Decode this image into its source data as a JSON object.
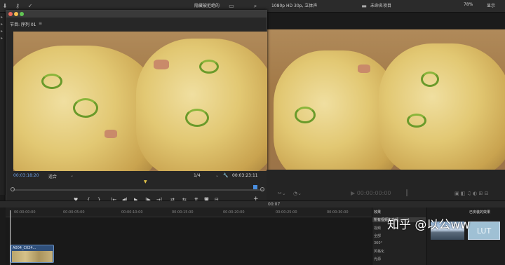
{
  "topbar": {
    "filter_label": "隐藏被拒绝的",
    "format_label": "1080p HD 30p, 立体声",
    "project_label": "未命名项目",
    "zoom_label": "78%",
    "display_label": "显示"
  },
  "viewer": {
    "title": "节目: 序列 01",
    "menu_glyph": "≡",
    "timecode_current": "00:03:18:20",
    "fit_label": "适合",
    "fit_arrow": "⌄",
    "quality_label": "1/4",
    "quality_arrow": "⌄",
    "wrench_glyph": "🔧",
    "timecode_duration": "00:03:23:11",
    "playhead_marker": "▼",
    "controls": [
      "♥",
      "{",
      "}",
      "|←",
      "◀|",
      "▶",
      "|▶",
      "→|",
      "⇄",
      "⇆",
      "⇈",
      "◙",
      "⊟"
    ],
    "add_button": "+"
  },
  "program_monitor": {
    "timecode": "▶ 00:00:00:00",
    "pause": "∥"
  },
  "timeline": {
    "header_time": "00:07",
    "ruler": [
      "00:00:00:00",
      "00:00:05:00",
      "00:00:10:00",
      "00:00:15:00",
      "00:00:20:00",
      "00:00:25:00",
      "00:00:30:00"
    ],
    "clip_label": "A004_C024..."
  },
  "effects": {
    "title": "效果",
    "items": [
      "所有视频和音频",
      "视频",
      "全部",
      "360°",
      "风格化",
      "光源"
    ]
  },
  "installed": {
    "title": "已安装的效果",
    "lut_label": "LUT"
  },
  "watermark": "知乎 @以公ww"
}
